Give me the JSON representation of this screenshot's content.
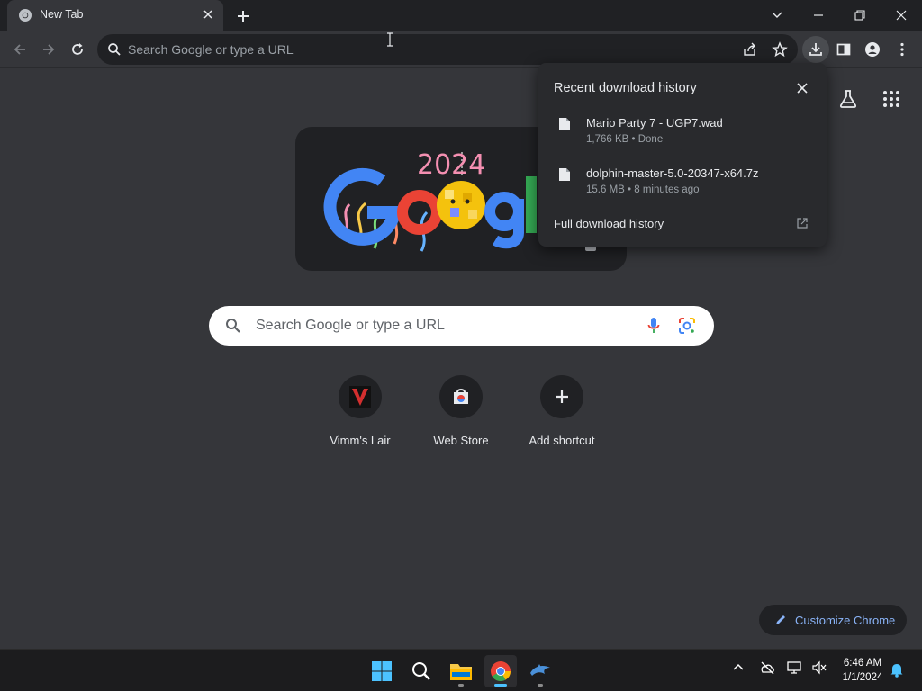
{
  "browser": {
    "tab_title": "New Tab",
    "omnibox_placeholder": "Search Google or type a URL"
  },
  "ntp": {
    "doodle": {
      "year": "2024",
      "word": "Google"
    },
    "search_placeholder": "Search Google or type a URL",
    "shortcuts": [
      {
        "label": "Vimm's Lair",
        "icon": "vimms-lair-icon"
      },
      {
        "label": "Web Store",
        "icon": "web-store-icon"
      },
      {
        "label": "Add shortcut",
        "icon": "plus-icon"
      }
    ],
    "customize_label": "Customize Chrome"
  },
  "downloads_popup": {
    "title": "Recent download history",
    "items": [
      {
        "name": "Mario Party 7 - UGP7.wad",
        "meta": "1,766 KB • Done"
      },
      {
        "name": "dolphin-master-5.0-20347-x64.7z",
        "meta": "15.6 MB • 8 minutes ago"
      }
    ],
    "full_history_label": "Full download history"
  },
  "taskbar": {
    "time": "6:46 AM",
    "date": "1/1/2024",
    "apps": [
      "windows-start",
      "search",
      "file-explorer",
      "chrome",
      "dolphin"
    ]
  },
  "colors": {
    "bg": "#35363a",
    "titlebar": "#202124",
    "accent_link": "#8ab4f8"
  }
}
